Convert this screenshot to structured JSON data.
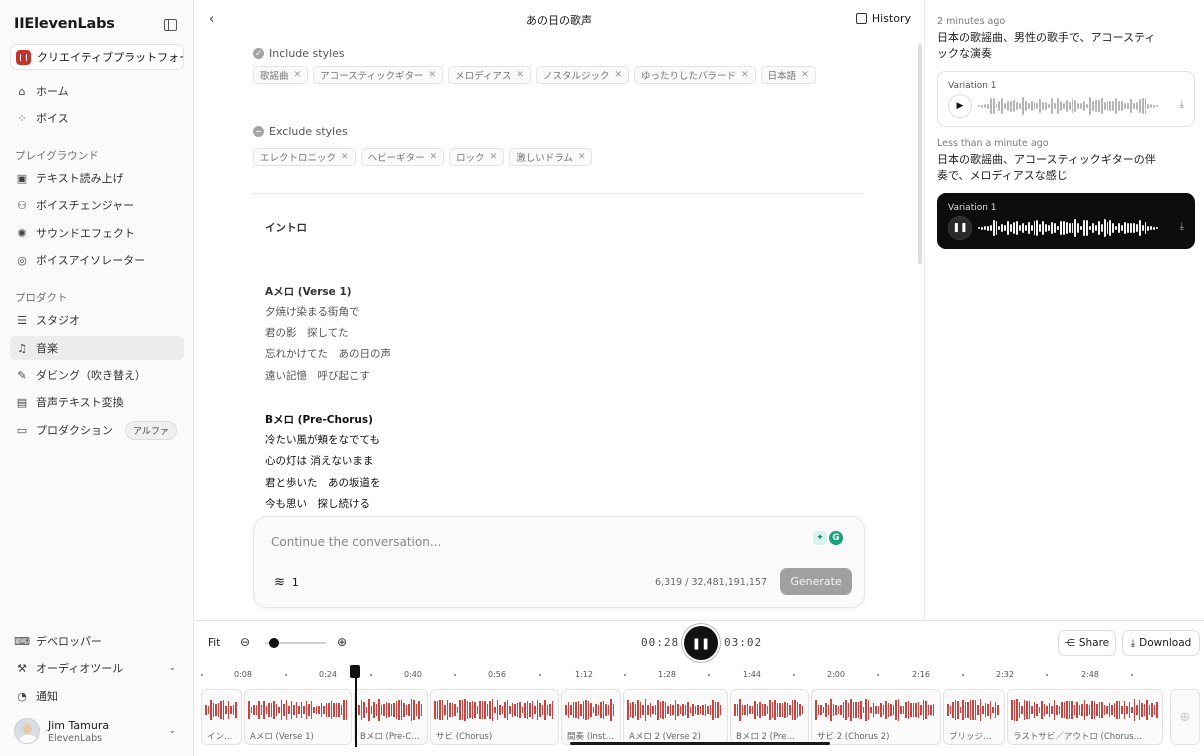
{
  "brand": {
    "logo": "IIElevenLabs",
    "accent": "#d0403c"
  },
  "workspace": {
    "label": "クリエイティブプラットフォーム"
  },
  "sidebar": {
    "nav": [
      {
        "label": "ホーム",
        "icon": "home-icon"
      },
      {
        "label": "ボイス",
        "icon": "voices-icon"
      }
    ],
    "playground_title": "プレイグラウンド",
    "playground": [
      {
        "label": "テキスト読み上げ",
        "icon": "text-to-speech-icon"
      },
      {
        "label": "ボイスチェンジャー",
        "icon": "voice-changer-icon"
      },
      {
        "label": "サウンドエフェクト",
        "icon": "sound-effect-icon"
      },
      {
        "label": "ボイスアイソレーター",
        "icon": "voice-isolator-icon"
      }
    ],
    "products_title": "プロダクト",
    "products": [
      {
        "label": "スタジオ",
        "icon": "studio-icon"
      },
      {
        "label": "音楽",
        "icon": "music-icon",
        "active": true
      },
      {
        "label": "ダビング（吹き替え）",
        "icon": "dubbing-icon"
      },
      {
        "label": "音声テキスト変換",
        "icon": "speech-to-text-icon"
      },
      {
        "label": "プロダクション",
        "icon": "production-icon",
        "badge": "アルファ"
      }
    ],
    "bottom": [
      {
        "label": "デベロッパー",
        "icon": "developer-icon"
      },
      {
        "label": "オーディオツール",
        "icon": "audio-tools-icon"
      },
      {
        "label": "通知",
        "icon": "notification-icon"
      }
    ],
    "user": {
      "name": "Jim Tamura",
      "org": "ElevenLabs"
    }
  },
  "topbar": {
    "title": "あの日の歌声",
    "history_label": "History"
  },
  "styles": {
    "include_title": "Include styles",
    "include": [
      "歌謡曲",
      "アコースティックギター",
      "メロディアス",
      "ノスタルジック",
      "ゆったりしたバラード",
      "日本語"
    ],
    "exclude_title": "Exclude styles",
    "exclude": [
      "エレクトロニック",
      "ヘビーギター",
      "ロック",
      "激しいドラム"
    ]
  },
  "lyrics": {
    "intro": "イントロ",
    "verse_title": "Aメロ (Verse 1)",
    "verse": [
      "夕焼け染まる街角で",
      "君の影　探してた",
      "忘れかけてた　あの日の声",
      "遠い記憶　呼び起こす"
    ],
    "prechorus_title": "Bメロ (Pre-Chorus)",
    "prechorus": [
      "冷たい風が頬をなでても",
      "心の灯は 消えないまま",
      "君と歩いた　あの坂道を",
      "今も思い　探し続ける"
    ]
  },
  "composer": {
    "placeholder": "Continue the conversation...",
    "layers_count": "1",
    "char_count": "6,319 / 32,481,191,157",
    "generate_label": "Generate"
  },
  "history": [
    {
      "time": "2 minutes ago",
      "prompt": "日本の歌謡曲、男性の歌手で、アコースティックな演奏",
      "variation": "Variation 1",
      "playing": false
    },
    {
      "time": "Less than a minute ago",
      "prompt": "日本の歌謡曲、アコースティックギターの伴奏で、メロディアスな感じ",
      "variation": "Variation 1",
      "playing": true
    }
  ],
  "player": {
    "fit_label": "Fit",
    "zoom_level": 0.15,
    "current_time": "00:28",
    "total_time": "03:02",
    "share_label": "Share",
    "download_label": "Download",
    "ruler": [
      "0:08",
      "0:24",
      "0:40",
      "0:56",
      "1:12",
      "1:28",
      "1:44",
      "2:00",
      "2:16",
      "2:32",
      "2:48"
    ],
    "sections": [
      "イン…",
      "Aメロ (Verse 1)",
      "Bメロ (Pre-C…",
      "サビ (Chorus)",
      "間奏 (Inst…",
      "Aメロ 2 (Verse 2)",
      "Bメロ 2 (Pre…",
      "サビ 2 (Chorus 2)",
      "ブリッジ…",
      "ラストサビ／アウトロ (Chorus…"
    ]
  }
}
